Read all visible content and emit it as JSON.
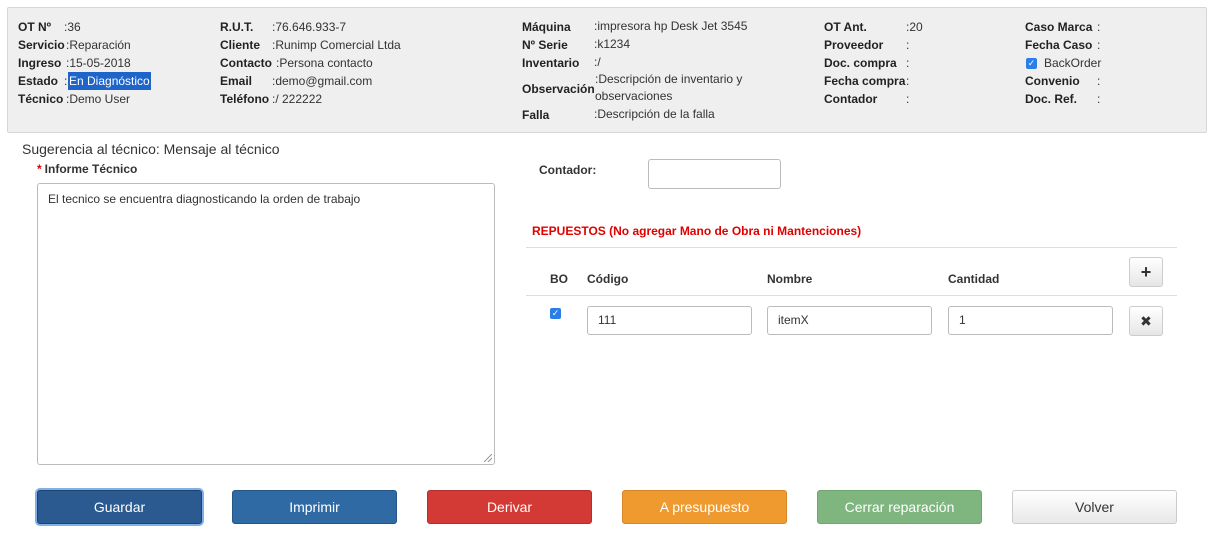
{
  "header": {
    "col1": [
      {
        "label": "OT Nº",
        "value": ":36"
      },
      {
        "label": "Servicio",
        "value": ":Reparación"
      },
      {
        "label": "Ingreso",
        "value": ":15-05-2018"
      },
      {
        "label": "Estado",
        "value": "En Diagnóstico"
      },
      {
        "label": "Técnico",
        "value": ":Demo User"
      }
    ],
    "estado_colon": ":",
    "col2": [
      {
        "label": "R.U.T.",
        "value": ":76.646.933-7"
      },
      {
        "label": "Cliente",
        "value": ":Runimp Comercial Ltda"
      },
      {
        "label": "Contacto",
        "value": ":Persona contacto"
      },
      {
        "label": "Email",
        "value": ":demo@gmail.com"
      },
      {
        "label": "Teléfono",
        "value": ":/ 222222"
      }
    ],
    "col3": [
      {
        "label": "Máquina",
        "value": ":impresora hp Desk Jet 3545"
      },
      {
        "label": "Nº Serie",
        "value": ":k1234"
      },
      {
        "label": "Inventario",
        "value": ":/"
      },
      {
        "label": "Observación",
        "value": ":Descripción de inventario y observaciones"
      },
      {
        "label": "Falla",
        "value": ":Descripción de la falla"
      }
    ],
    "col4": [
      {
        "label": "OT Ant.",
        "value": ":20"
      },
      {
        "label": "Proveedor",
        "value": ":"
      },
      {
        "label": "Doc. compra",
        "value": ":"
      },
      {
        "label": "Fecha compra",
        "value": ":"
      },
      {
        "label": "Contador",
        "value": ":"
      }
    ],
    "col5": [
      {
        "label": "Caso Marca",
        "value": ":"
      },
      {
        "label": "Fecha Caso",
        "value": ":"
      },
      {
        "label": "Convenio",
        "value": ":"
      },
      {
        "label": "Doc. Ref.",
        "value": ":"
      }
    ],
    "backorder_label": "BackOrder"
  },
  "sugerencia": "Sugerencia al técnico: Mensaje al técnico",
  "informe": {
    "required_mark": "*",
    "label": "Informe Técnico",
    "value": "El tecnico se encuentra diagnosticando la orden de trabajo"
  },
  "contador": {
    "label": "Contador:",
    "value": ""
  },
  "repuestos": {
    "title": "REPUESTOS (No agregar Mano de Obra ni Mantenciones)",
    "columns": [
      "BO",
      "Código",
      "Nombre",
      "Cantidad"
    ],
    "add_icon": "+",
    "remove_icon": "✖",
    "rows": [
      {
        "bo": true,
        "codigo": "111",
        "nombre": "itemX",
        "cantidad": "1"
      }
    ]
  },
  "actions": [
    {
      "label": "Guardar",
      "color": "#2a5a8f"
    },
    {
      "label": "Imprimir",
      "color": "#2f6aa4"
    },
    {
      "label": "Derivar",
      "color": "#d33a35"
    },
    {
      "label": "A presupuesto",
      "color": "#ef9a2f"
    },
    {
      "label": "Cerrar reparación",
      "color": "#7fb67f"
    },
    {
      "label": "Volver",
      "color": "#f3f3f3"
    }
  ]
}
